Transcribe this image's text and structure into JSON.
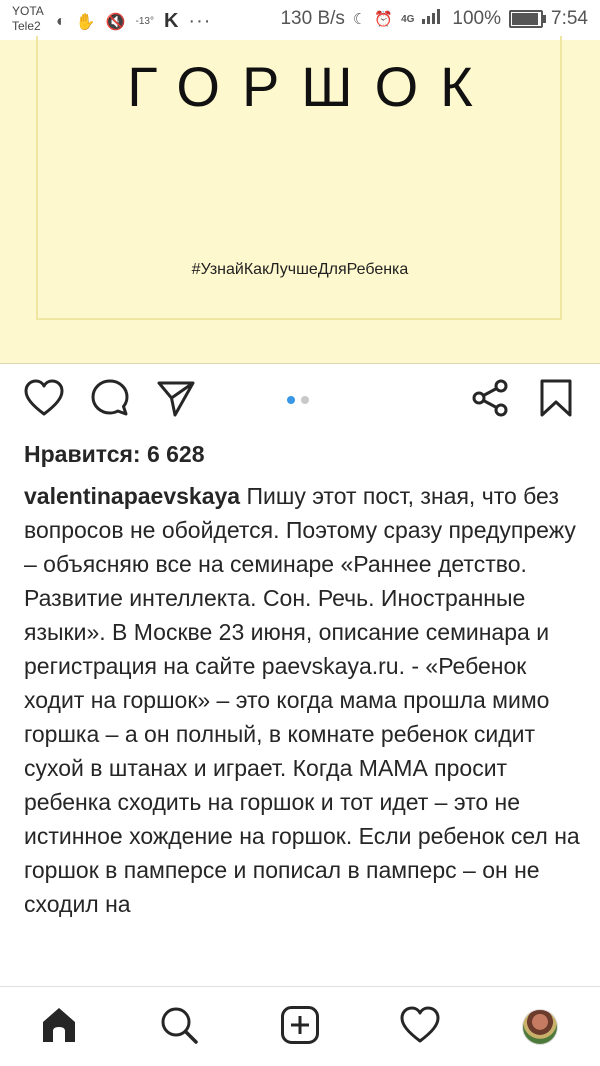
{
  "status_bar": {
    "carrier_1": "YOTA",
    "carrier_2": "Tele2",
    "temperature": "-13°",
    "app_letter": "K",
    "more": "···",
    "net_speed": "130 B/s",
    "network": "4G",
    "battery_percent": "100%",
    "battery_level": 1.0,
    "time": "7:54"
  },
  "post": {
    "image_title": "ГОРШОК",
    "image_hashtag": "#УзнайКакЛучшеДляРебенка",
    "carousel": {
      "count": 2,
      "active_index": 0
    },
    "likes": "Нравится: 6 628",
    "author": "valentinapaevskaya",
    "caption": "Пишу этот пост, зная, что без вопросов не обойдется. Поэтому сразу предупрежу – объясняю все на семинаре «Раннее детство. Развитие интеллекта. Сон. Речь. Иностранные языки». В Москве 23 июня, описание семинара и регистрация на сайте paevskaya.ru. - «Ребенок ходит на горшок» – это когда мама прошла мимо горшка – а он полный, в комнате ребенок сидит сухой в штанах и играет. Когда МАМА просит ребенка сходить на горшок и тот идет – это не истинное хождение на горшок. Если ребенок сел на горшок в памперсе и пописал в памперс – он не сходил на"
  },
  "actions": {
    "like_icon": "heart-icon",
    "comment_icon": "comment-icon",
    "share_icon": "send-icon",
    "share2_icon": "share-icon",
    "save_icon": "bookmark-icon"
  },
  "bottom_nav": {
    "items": [
      "home-icon",
      "search-icon",
      "add-post-icon",
      "activity-heart-icon",
      "profile-avatar"
    ]
  },
  "colors": {
    "image_background": "#fdf8cd",
    "dot_active": "#3a97e6",
    "text": "#262626"
  }
}
